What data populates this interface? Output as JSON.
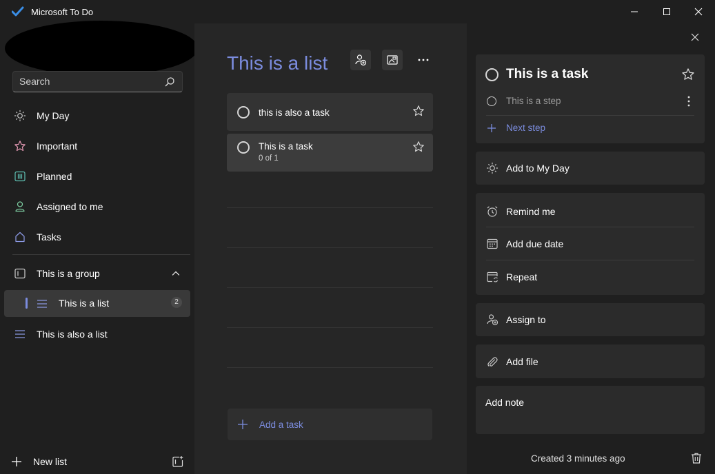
{
  "window": {
    "title": "Microsoft To Do"
  },
  "colors": {
    "accent": "#7b8cde",
    "logo": "#3a8ee6",
    "background": "#1f1f1f",
    "middle_pane": "#262626"
  },
  "sidebar": {
    "search": {
      "placeholder": "Search"
    },
    "smart_lists": [
      {
        "label": "My Day",
        "icon": "sun-icon"
      },
      {
        "label": "Important",
        "icon": "star-icon"
      },
      {
        "label": "Planned",
        "icon": "calendar-grid-icon"
      },
      {
        "label": "Assigned to me",
        "icon": "person-icon"
      },
      {
        "label": "Tasks",
        "icon": "home-icon"
      }
    ],
    "group": {
      "label": "This is a group",
      "icon": "group-icon",
      "expanded": true
    },
    "group_lists": [
      {
        "label": "This is a list",
        "count": "2",
        "icon": "list-icon",
        "selected": true
      }
    ],
    "lists": [
      {
        "label": "This is also a list",
        "icon": "list-icon"
      }
    ],
    "new_list_label": "New list"
  },
  "main": {
    "list_title": "This is a list",
    "tasks": [
      {
        "title": "this is also a task",
        "subtitle": "",
        "selected": false
      },
      {
        "title": "This is a task",
        "subtitle": "0 of 1",
        "selected": true
      }
    ],
    "add_task_label": "Add a task"
  },
  "detail": {
    "task_title": "This is a task",
    "steps": [
      {
        "label": "This is a step"
      }
    ],
    "next_step_label": "Next step",
    "add_to_my_day": "Add to My Day",
    "remind_me": "Remind me",
    "add_due_date": "Add due date",
    "repeat": "Repeat",
    "assign_to": "Assign to",
    "add_file": "Add file",
    "note_placeholder": "Add note",
    "created": "Created 3 minutes ago"
  }
}
